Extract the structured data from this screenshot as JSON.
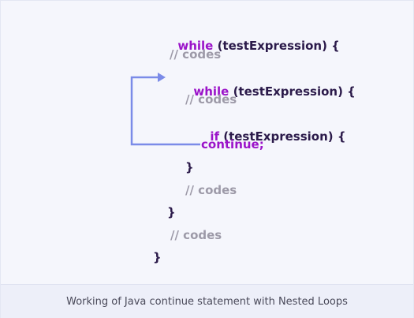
{
  "code": {
    "outer_while_kw": "while",
    "outer_while_rest": " (testExpression) {",
    "comment_1": "// codes",
    "inner_while_kw": "while",
    "inner_while_rest": " (testExpression) {",
    "comment_2": "// codes",
    "if_kw": "if",
    "if_rest": " (testExpression) {",
    "continue_stmt": "continue;",
    "close_if": "}",
    "comment_3": "// codes",
    "close_inner": "}",
    "comment_4": "// codes",
    "close_outer": "}"
  },
  "caption": "Working of Java continue statement with Nested Loops",
  "colors": {
    "keyword": "#9b13c9",
    "text": "#2b1a4a",
    "comment": "#9d9aa8",
    "arrow": "#7b8be8",
    "background": "#f5f6fc",
    "caption_bar": "#edeff9"
  }
}
